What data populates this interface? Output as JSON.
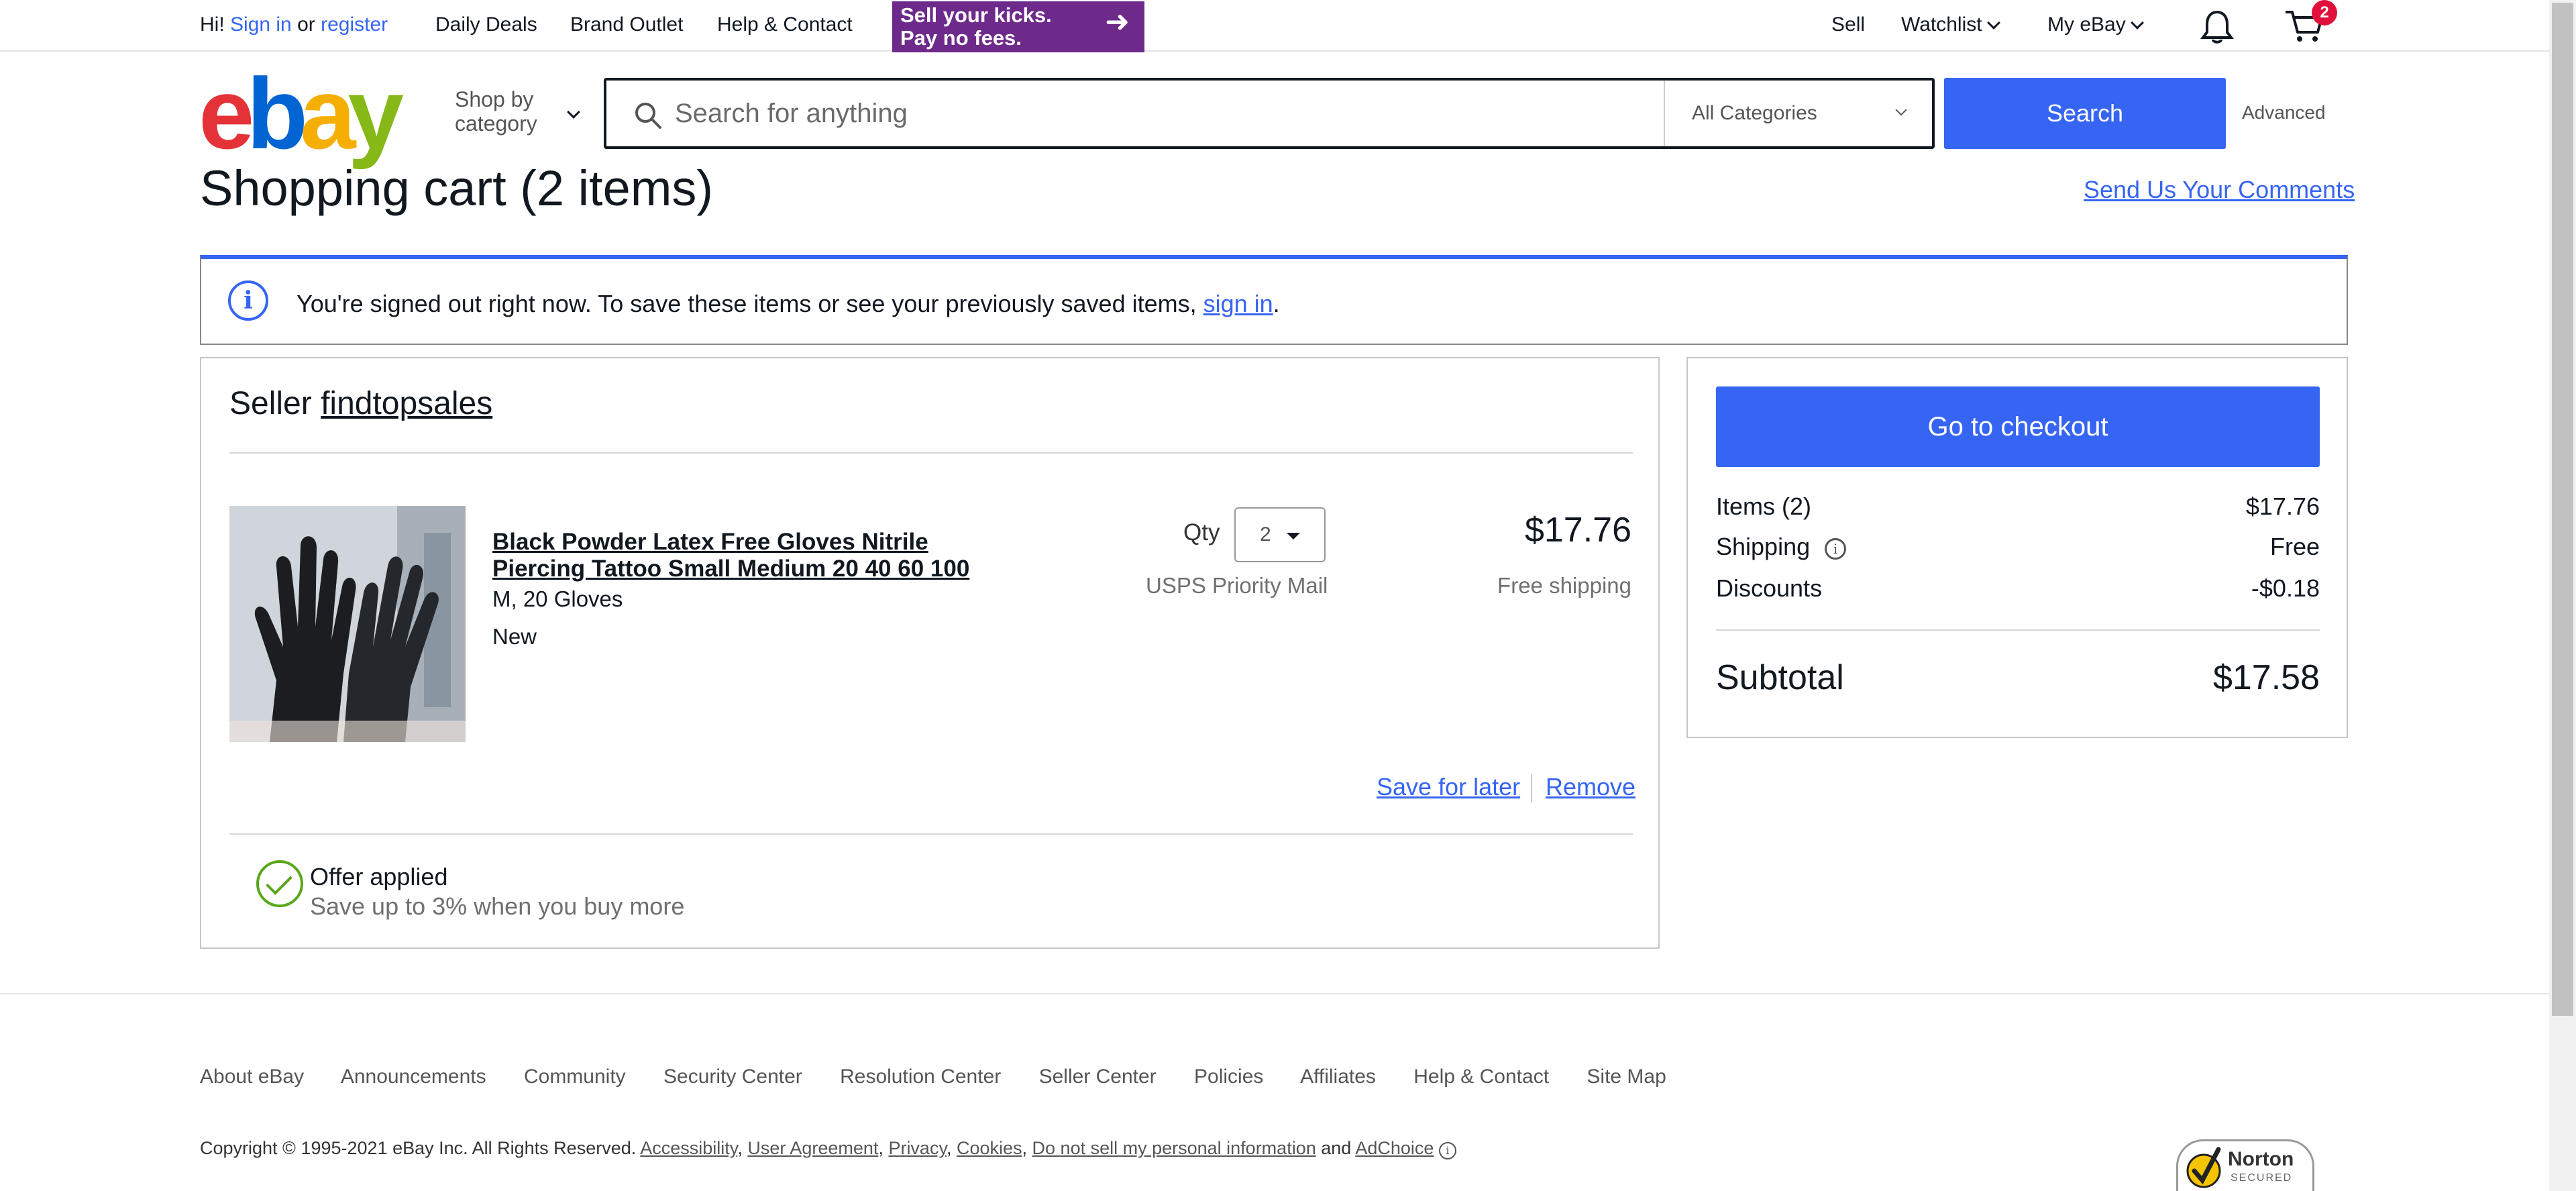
{
  "topbar": {
    "greeting_prefix": "Hi!",
    "sign_in": "Sign in",
    "or": "or",
    "register": "register",
    "daily_deals": "Daily Deals",
    "brand_outlet": "Brand Outlet",
    "help_contact": "Help & Contact",
    "promo_line1": "Sell your kicks.",
    "promo_line2": "Pay no fees.",
    "sell": "Sell",
    "watchlist": "Watchlist",
    "my_ebay": "My eBay",
    "cart_count": "2"
  },
  "header": {
    "logo": [
      "e",
      "b",
      "a",
      "y"
    ],
    "shop_by_line1": "Shop by",
    "shop_by_line2": "category",
    "search_placeholder": "Search for anything",
    "category_select": "All Categories",
    "search_button": "Search",
    "advanced": "Advanced"
  },
  "page": {
    "title": "Shopping cart (2 items)",
    "comments_link": "Send Us Your Comments"
  },
  "alert": {
    "message": "You're signed out right now. To save these items or see your previously saved items, ",
    "link": "sign in",
    "suffix": "."
  },
  "cart": {
    "seller_label": "Seller",
    "seller_name": "findtopsales",
    "item": {
      "title": "Black Powder Latex Free Gloves Nitrile Piercing Tattoo Small Medium 20 40 60 100",
      "variant": "M, 20 Gloves",
      "condition": "New",
      "qty_label": "Qty",
      "qty_value": "2",
      "shipping_method": "USPS Priority Mail",
      "price": "$17.76",
      "shipping_cost": "Free shipping",
      "save_for_later": "Save for later",
      "remove": "Remove"
    },
    "offer": {
      "title": "Offer applied",
      "subtitle": "Save up to 3% when you buy more"
    }
  },
  "summary": {
    "checkout_button": "Go to checkout",
    "items_label": "Items (2)",
    "items_value": "$17.76",
    "shipping_label": "Shipping",
    "shipping_value": "Free",
    "discounts_label": "Discounts",
    "discounts_value": "-$0.18",
    "subtotal_label": "Subtotal",
    "subtotal_value": "$17.58"
  },
  "footer": {
    "links": [
      "About eBay",
      "Announcements",
      "Community",
      "Security Center",
      "Resolution Center",
      "Seller Center",
      "Policies",
      "Affiliates",
      "Help & Contact",
      "Site Map"
    ],
    "copyright": "Copyright © 1995-2021 eBay Inc. All Rights Reserved.",
    "legal_links": [
      "Accessibility",
      "User Agreement",
      "Privacy",
      "Cookies",
      "Do not sell my personal information"
    ],
    "and": "and",
    "adchoice": "AdChoice",
    "norton_line1": "Norton",
    "norton_line2": "SECURED"
  },
  "colors": {
    "accent": "#3665f3",
    "offer_green": "#5ba71b",
    "badge_red": "#e0103a",
    "promo_purple": "#6d2a8b"
  }
}
